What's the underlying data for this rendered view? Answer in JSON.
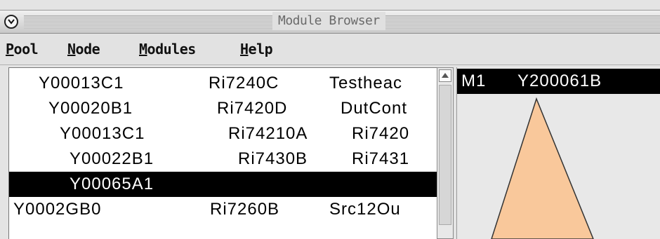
{
  "window": {
    "title": "Module Browser"
  },
  "menubar": {
    "items": [
      {
        "mnemonic": "P",
        "rest": "ool"
      },
      {
        "mnemonic": "N",
        "rest": "ode"
      },
      {
        "mnemonic": "M",
        "rest": "odules"
      },
      {
        "mnemonic": "H",
        "rest": "elp"
      }
    ]
  },
  "module_list": {
    "rows": [
      {
        "id": "Y00013C1",
        "type": "Ri7240C",
        "name": "Testheac",
        "selected": false
      },
      {
        "id": "Y00020B1",
        "type": "Ri7420D",
        "name": "DutCont",
        "selected": false
      },
      {
        "id": "Y00013C1",
        "type": "Ri74210A",
        "name": "Ri7420",
        "selected": false
      },
      {
        "id": "Y00022B1",
        "type": "Ri7430B",
        "name": "Ri7431",
        "selected": false
      },
      {
        "id": "Y00065A1",
        "type": "",
        "name": "",
        "selected": true
      },
      {
        "id": "Y0002GB0",
        "type": "Ri7260B",
        "name": "Src12Ou",
        "selected": false
      }
    ]
  },
  "module_detail": {
    "slot": "M1",
    "id": "Y200061B"
  },
  "colors": {
    "selection": "#000000",
    "callout_fill": "#f9c89b",
    "window_bg": "#e4e4e4"
  },
  "icons": {
    "collapse": "chevron-down-icon",
    "scroll_up": "arrow-up-icon"
  }
}
